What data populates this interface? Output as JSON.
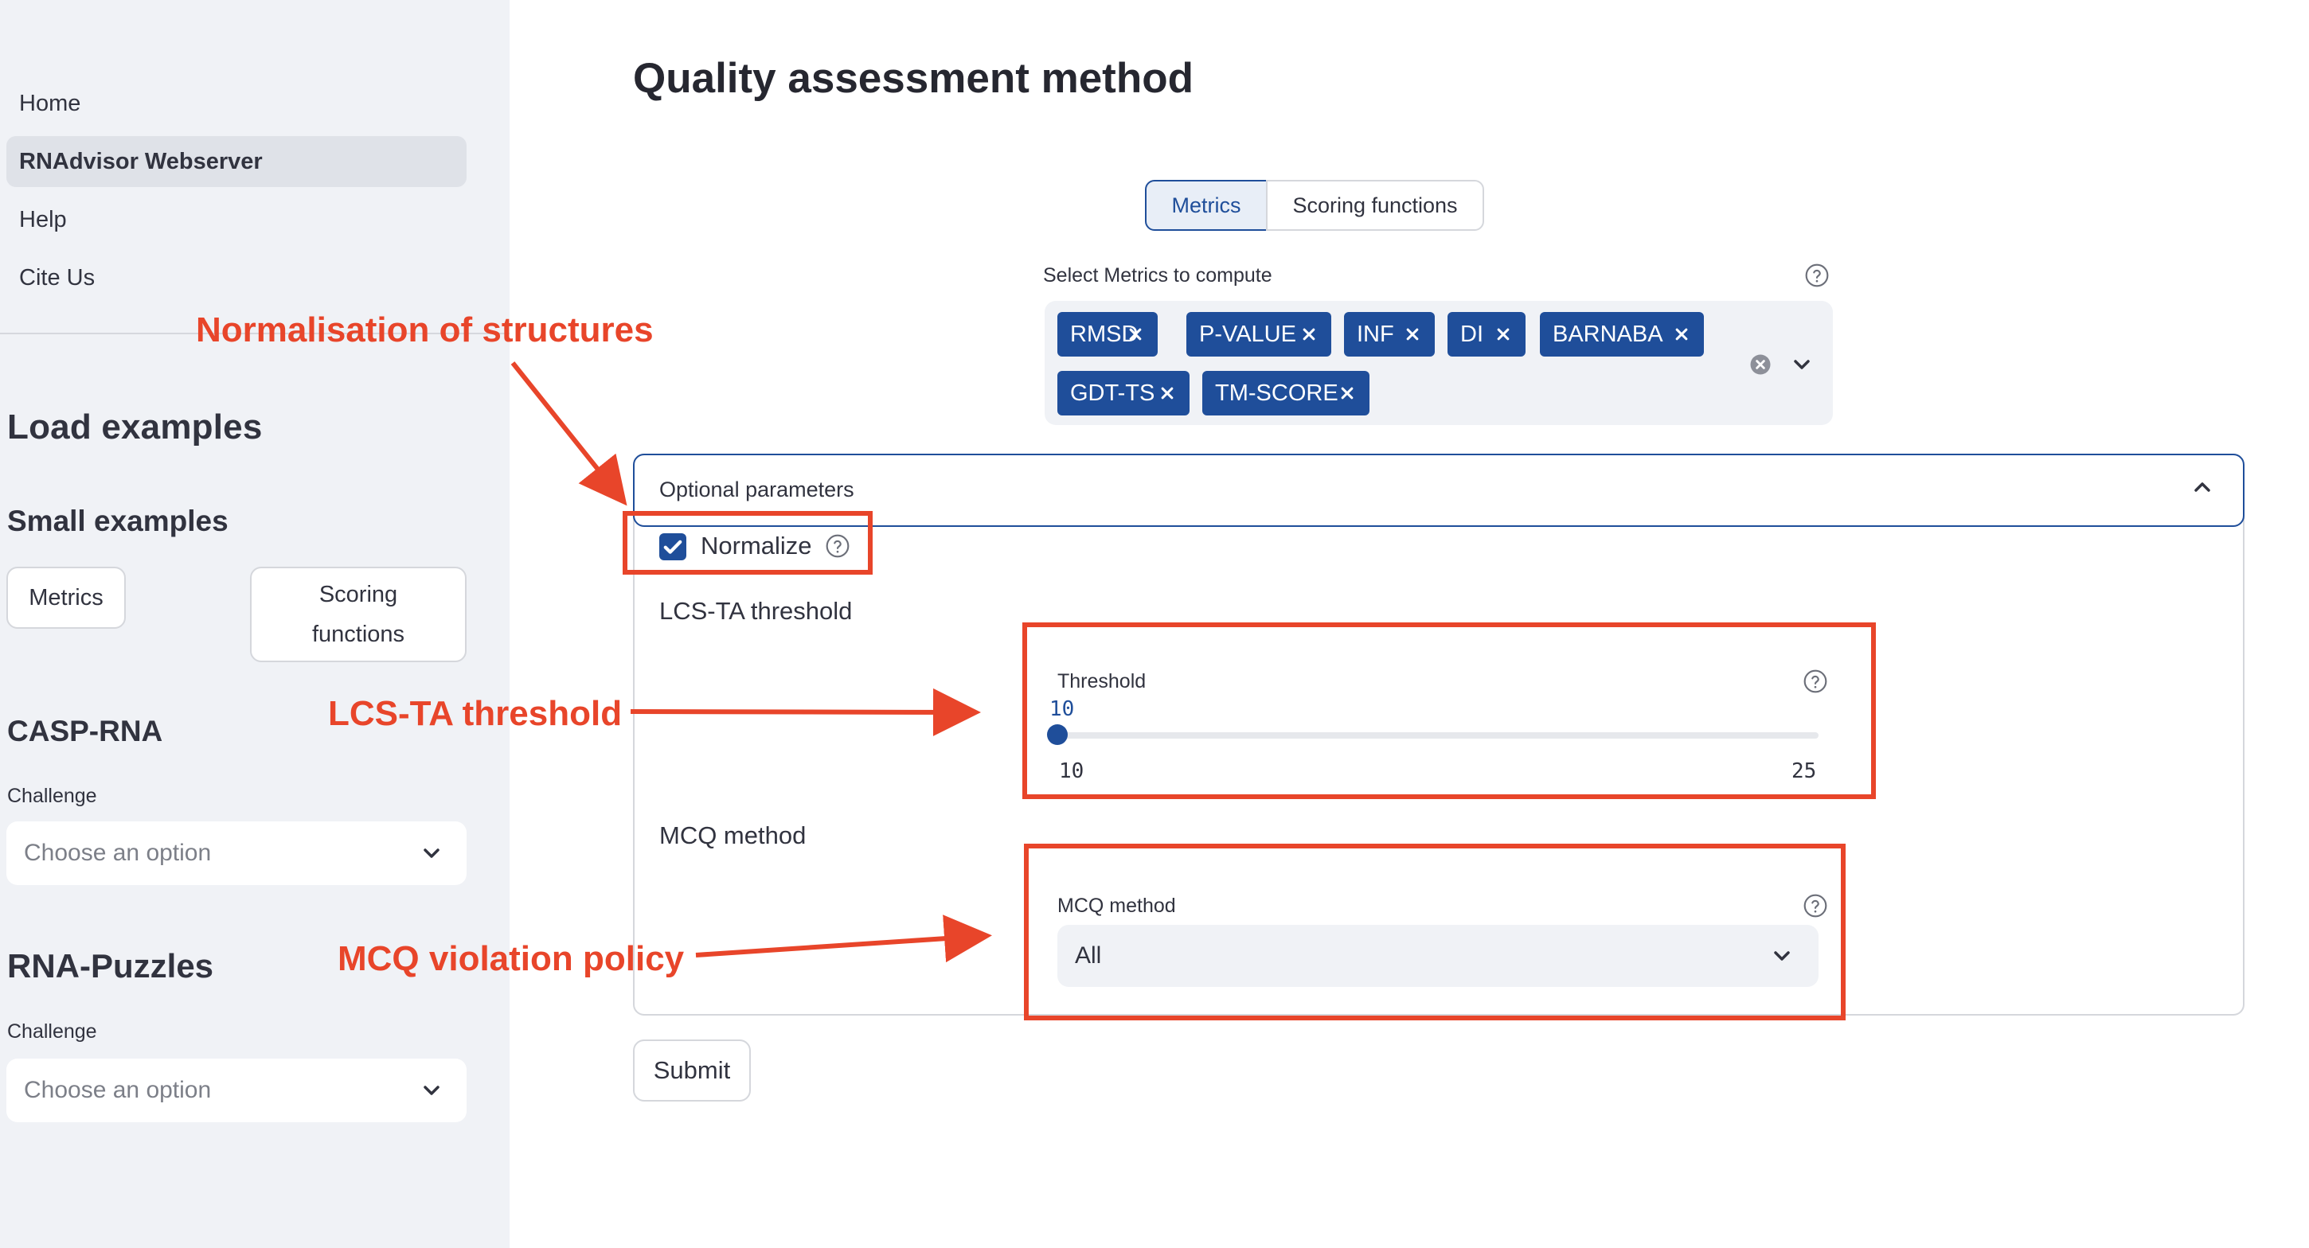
{
  "sidebar": {
    "nav": [
      "Home",
      "RNAdvisor Webserver",
      "Help",
      "Cite Us"
    ],
    "active_nav": "RNAdvisor Webserver",
    "load_examples_heading": "Load examples",
    "small_examples_heading": "Small examples",
    "small_example_buttons": [
      "Metrics",
      "Scoring functions"
    ],
    "casp": {
      "heading": "CASP-RNA",
      "label": "Challenge",
      "placeholder": "Choose an option"
    },
    "puzzles": {
      "heading": "RNA-Puzzles",
      "label": "Challenge",
      "placeholder": "Choose an option"
    }
  },
  "main": {
    "title": "Quality assessment method",
    "tabs": [
      "Metrics",
      "Scoring functions"
    ],
    "active_tab": "Metrics",
    "metrics_select": {
      "label": "Select Metrics to compute",
      "chips": [
        "RMSD",
        "P-VALUE",
        "INF",
        "DI",
        "BARNABA",
        "GDT-TS",
        "TM-SCORE"
      ]
    },
    "optional": {
      "title": "Optional parameters",
      "normalize": {
        "label": "Normalize",
        "checked": true
      },
      "lcs_heading": "LCS-TA threshold",
      "threshold": {
        "label": "Threshold",
        "value": 10,
        "min": 10,
        "max": 25
      },
      "mcq_heading": "MCQ method",
      "mcq_select": {
        "label": "MCQ method",
        "value": "All"
      }
    },
    "submit_label": "Submit"
  },
  "annotations": {
    "normalisation": "Normalisation of structures",
    "lcs": "LCS-TA threshold",
    "mcq": "MCQ violation policy"
  },
  "colors": {
    "accent": "#1f4e9a",
    "annotation": "#e8452a",
    "sidebar_bg": "#f0f2f6"
  },
  "icons": [
    "help-icon",
    "close-icon",
    "clear-icon",
    "chevron-down-icon",
    "chevron-up-icon",
    "check-icon"
  ]
}
